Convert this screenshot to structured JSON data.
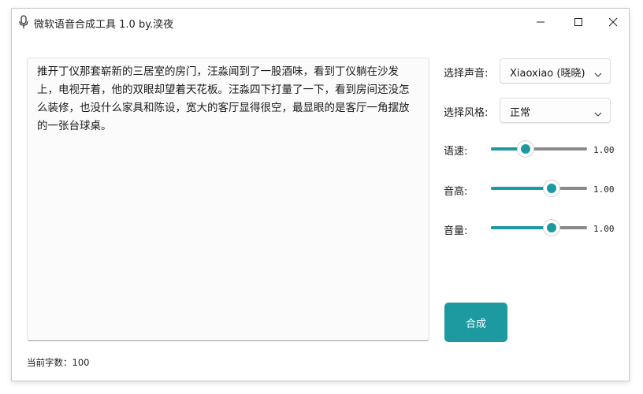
{
  "window": {
    "title": "微软语音合成工具 1.0 by.湙夜",
    "controls": [
      "minimize",
      "maximize",
      "close"
    ]
  },
  "editor": {
    "text": "推开丁仪那套崭新的三居室的房门，汪淼闻到了一股酒味，看到丁仪躺在沙发上，电视开着，他的双眼却望着天花板。汪淼四下打量了一下，看到房间还没怎么装修，也没什么家具和陈设，宽大的客厅显得很空，最显眼的是客厅一角摆放的一张台球桌。"
  },
  "voice": {
    "label": "选择声音:",
    "selected": "Xiaoxiao (晓晓)"
  },
  "style": {
    "label": "选择风格:",
    "selected": "正常"
  },
  "sliders": [
    {
      "label": "语速:",
      "display": "1.00",
      "fraction": 0.36
    },
    {
      "label": "音高:",
      "display": "1.00",
      "fraction": 0.63
    },
    {
      "label": "音量:",
      "display": "1.00",
      "fraction": 0.63
    }
  ],
  "synthesize": {
    "label": "合成"
  },
  "status": {
    "char_count": "当前字数：100"
  },
  "colors": {
    "accent": "#1c9aa0",
    "track": "#8a8a8a"
  }
}
